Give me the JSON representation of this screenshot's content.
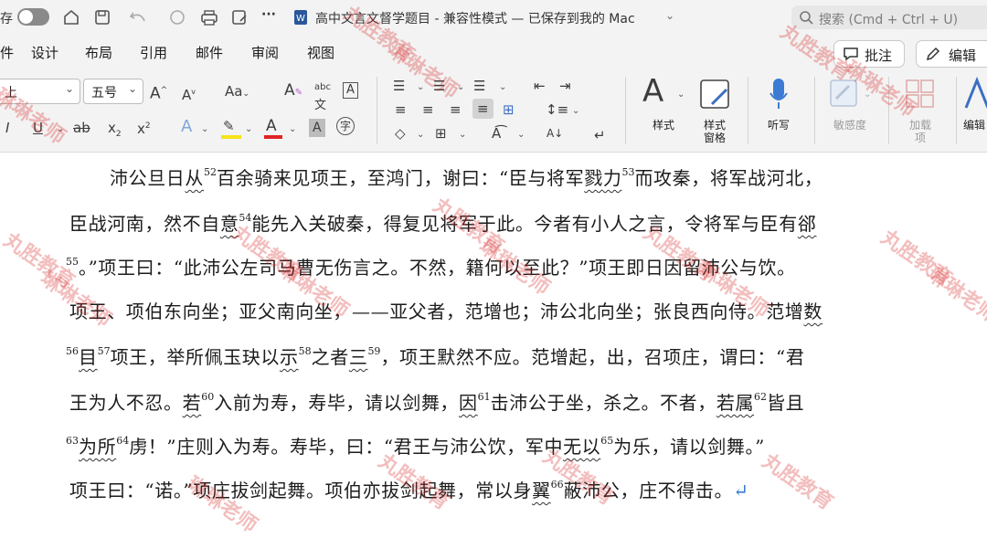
{
  "titlebar": {
    "left_cut_char": "存",
    "doc_title": "高中文言文督学题目 - 兼容性模式 — 已保存到我的 Mac",
    "more": "···",
    "search_placeholder": "搜索 (Cmd + Ctrl + U)"
  },
  "menu": {
    "items": [
      "件",
      "设计",
      "布局",
      "引用",
      "邮件",
      "审阅",
      "视图"
    ],
    "comment_btn": "批注",
    "edit_btn": "编辑"
  },
  "ribbon": {
    "font_name": "上",
    "font_size": "五号",
    "grow_font": "A^",
    "shrink_font": "A^",
    "change_case": "Aa",
    "pinyin": "abc",
    "styles_label": "样式",
    "styles_pane_label": "样式\n窗格",
    "dictate_label": "听写",
    "sensitivity_label": "敏感度",
    "addins_label": "加载\n项",
    "editor_label": "编辑"
  },
  "document": {
    "lines": [
      {
        "segs": [
          [
            "沛公旦日",
            ""
          ],
          [
            "从",
            "w"
          ],
          [
            "52",
            "s"
          ],
          [
            "百余骑来见项王，至鸿门，谢曰：“臣与将军",
            ""
          ],
          [
            "戮力",
            "w"
          ],
          [
            "53",
            "s"
          ],
          [
            "而攻秦，将军战河北，",
            ""
          ]
        ]
      },
      {
        "segs": [
          [
            "臣战河南，然不自",
            ""
          ],
          [
            "意",
            "w"
          ],
          [
            "54",
            "s"
          ],
          [
            "能先入关破秦，得复见将军于此。今者有小人之言，令将军与臣有",
            ""
          ],
          [
            "郤",
            "w"
          ]
        ]
      },
      {
        "segs": [
          [
            "55",
            "s"
          ],
          [
            "。”项王曰：“此沛公左司马曹无伤言之。不然，籍何以至此？”项王即日因留沛公与饮。",
            ""
          ]
        ]
      },
      {
        "segs": [
          [
            "项王、项伯东向坐；亚父南向坐，——亚父者，范增也；沛公北向坐；张良西向侍。范增",
            ""
          ],
          [
            "数",
            "w"
          ]
        ]
      },
      {
        "segs": [
          [
            "56",
            "s"
          ],
          [
            "目",
            "w"
          ],
          [
            "57",
            "s"
          ],
          [
            "项王，举所佩玉玦以",
            ""
          ],
          [
            "示",
            "w"
          ],
          [
            "58",
            "s"
          ],
          [
            "之者",
            ""
          ],
          [
            "三",
            "w"
          ],
          [
            "59",
            "s"
          ],
          [
            "，项王默然不应。范增起，出，召项庄，谓曰：“君",
            ""
          ]
        ]
      },
      {
        "segs": [
          [
            "王为人不忍。",
            ""
          ],
          [
            "若",
            "w"
          ],
          [
            "60",
            "s"
          ],
          [
            "入前为寿，寿毕，请以剑舞，",
            ""
          ],
          [
            "因",
            "w"
          ],
          [
            "61",
            "s"
          ],
          [
            "击沛公于坐，杀之。不者，",
            ""
          ],
          [
            "若属",
            "w"
          ],
          [
            "62",
            "s"
          ],
          [
            "皆且",
            ""
          ]
        ]
      },
      {
        "segs": [
          [
            "63",
            "s"
          ],
          [
            "为所",
            "w"
          ],
          [
            "64",
            "s"
          ],
          [
            "虏！”庄则入为寿。寿毕，曰：“君王与沛公饮，军中",
            ""
          ],
          [
            "无以",
            "w"
          ],
          [
            "65",
            "s"
          ],
          [
            "为乐，请以剑舞。”",
            ""
          ]
        ]
      },
      {
        "segs": [
          [
            "项王曰：“诺。”项庄拔剑起舞。项伯亦拔剑起舞，常以身",
            ""
          ],
          [
            "翼",
            "w"
          ],
          [
            "66",
            "s"
          ],
          [
            "蔽沛公，庄不得击。",
            ""
          ],
          [
            "↵",
            "r"
          ]
        ]
      }
    ]
  },
  "watermark": {
    "text_a": "丸胜教育",
    "text_b": "琳琳老师"
  },
  "colors": {
    "highlight": "#f5e21b",
    "font_color": "#e02424",
    "watermark": "#d62828",
    "paragraph_mark": "#3b7bd4"
  },
  "icons": [
    "home-icon",
    "save-icon",
    "undo-icon",
    "redo-icon",
    "print-icon",
    "save-as-icon",
    "more-icon",
    "word-doc-icon",
    "search-icon",
    "comment-icon",
    "pencil-icon",
    "microphone-icon"
  ]
}
